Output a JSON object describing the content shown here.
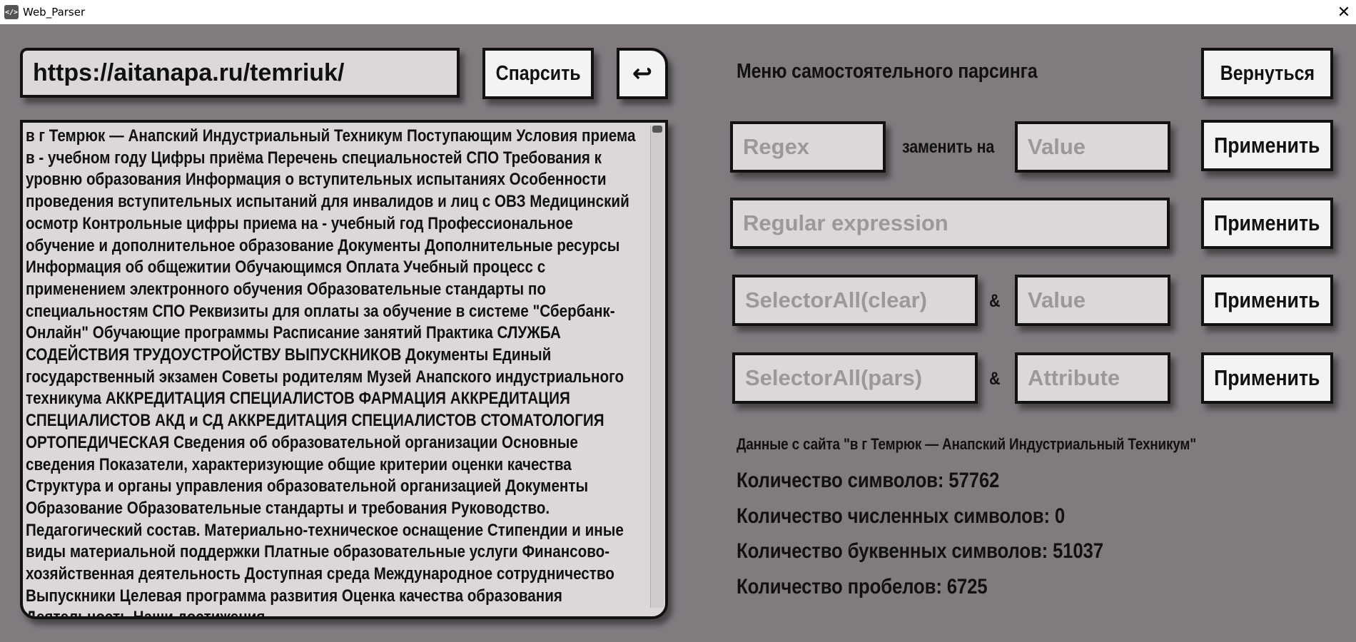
{
  "window": {
    "title": "Web_Parser",
    "app_icon": "</>",
    "close_glyph": "✕"
  },
  "toolbar": {
    "url_value": "https://aitanapa.ru/temriuk/",
    "parse_label": "Спарсить",
    "undo_glyph": "↩"
  },
  "text_area": {
    "content": " в г Темрюк — Анапский Индустриальный Техникум Поступающим Условия приема в - учебном году Цифры приёма Перечень специальностей СПО Требования к уровню образования Информация о вступительных испытаниях Особенности проведения вступительных испытаний для инвалидов и лиц с ОВЗ Медицинский осмотр Контрольные цифры приема на - учебный год Профессиональное обучение и дополнительное образование Документы Дополнительные ресурсы Информация об общежитии Обучающимся Оплата Учебный процесс с применением электронного обучения Образовательные стандарты по специальностям СПО Реквизиты для оплаты за обучение в системе \"Сбербанк-Онлайн\" Обучающие программы Расписание занятий Практика СЛУЖБА СОДЕЙСТВИЯ ТРУДОУСТРОЙСТВУ ВЫПУСКНИКОВ Документы Единый государственный экзамен  Советы родителям Музей Анапского индустриального техникума АККРЕДИТАЦИЯ СПЕЦИАЛИСТОВ ФАРМАЦИЯ АККРЕДИТАЦИЯ СПЕЦИАЛИСТОВ АКД и СД АККРЕДИТАЦИЯ СПЕЦИАЛИСТОВ СТОМАТОЛОГИЯ ОРТОПЕДИЧЕСКАЯ Сведения об образовательной организации Основные сведения Показатели, характеризующие общие критерии оценки качества Структура и органы управления образовательной организацией Документы Образование Образовательные стандарты и требования Руководство. Педагогический состав. Материально-техническое оснащение Стипендии и иные виды материальной поддержки Платные образовательные услуги Финансово-хозяйственная деятельность Доступная среда Международное сотрудничество Выпускники Целевая программа развития Оценка качества образования Деятельность Наши достижения"
  },
  "menu": {
    "title": "Меню самостоятельного парсинга",
    "back_label": "Вернуться",
    "rows": [
      {
        "left_placeholder": "Regex",
        "connector": "заменить на",
        "right_placeholder": "Value",
        "apply_label": "Применить"
      },
      {
        "left_placeholder": "Regular expression",
        "apply_label": "Применить"
      },
      {
        "left_placeholder": "SelectorAll(clear)",
        "connector": "&",
        "right_placeholder": "Value",
        "apply_label": "Применить"
      },
      {
        "left_placeholder": "SelectorAll(pars)",
        "connector": "&",
        "right_placeholder": "Attribute",
        "apply_label": "Применить"
      }
    ]
  },
  "stats": {
    "site_data": "Данные с сайта \"в г Темрюк — Анапский Индустриальный Техникум\"",
    "chars": "Количество символов: 57762",
    "digits": "Количество численных символов: 0",
    "letters": "Количество буквенных символов: 51037",
    "spaces": "Количество пробелов: 6725"
  },
  "colors": {
    "background": "#817b80",
    "field_bg": "#dcd8d9",
    "button_bg": "#f3f3f3",
    "border": "#111111",
    "placeholder": "#9c9899"
  }
}
